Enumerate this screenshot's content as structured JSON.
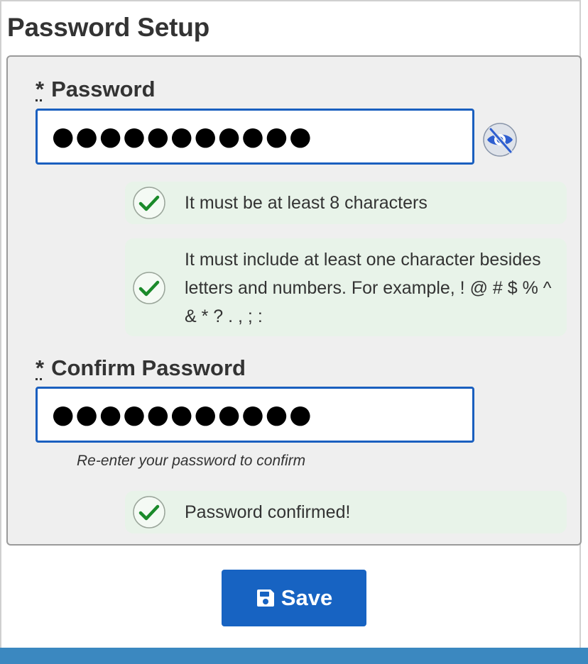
{
  "page": {
    "title": "Password Setup"
  },
  "password_field": {
    "required_marker": "*",
    "label": "Password",
    "masked_value": "●●●●●●●●●●●",
    "toggle_icon": "eye-slash-icon"
  },
  "rules": [
    {
      "text": "It must be at least 8 characters",
      "status": "met",
      "icon": "check-circle-icon"
    },
    {
      "text": "It must include at least one character besides letters and numbers. For example, ! @ # $ % ^ & * ? . , ; :",
      "status": "met",
      "icon": "check-circle-icon"
    }
  ],
  "confirm_field": {
    "required_marker": "*",
    "label": "Confirm Password",
    "masked_value": "●●●●●●●●●●●",
    "hint": "Re-enter your password to confirm",
    "status_text": "Password confirmed!",
    "status_icon": "check-circle-icon"
  },
  "actions": {
    "save_label": "Save",
    "save_icon": "floppy-disk-icon"
  },
  "colors": {
    "accent": "#1763c2",
    "input_border": "#1a5fbf",
    "success": "#1a8a2a",
    "success_bg": "#e8f3e9",
    "panel_bg": "#efefef",
    "footer_bar": "#3b88c0"
  }
}
